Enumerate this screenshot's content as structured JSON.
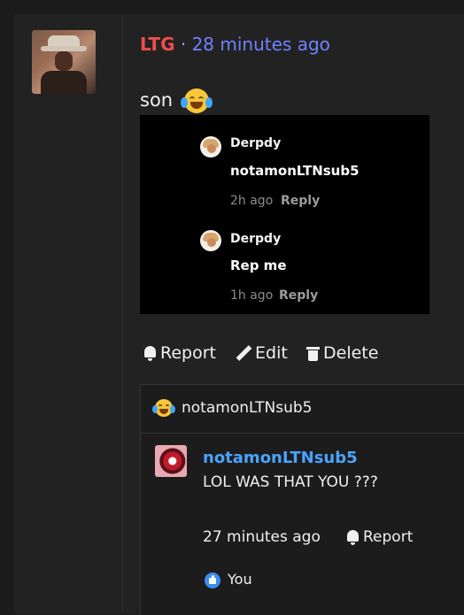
{
  "comment": {
    "author": "LTG",
    "separator": "·",
    "time": "28 minutes ago",
    "body": "son",
    "embed": {
      "replies": [
        {
          "name": "Derpdy",
          "text": "notamonLTNsub5",
          "time": "2h ago",
          "reply_label": "Reply"
        },
        {
          "name": "Derpdy",
          "text": "Rep me",
          "time": "1h ago",
          "reply_label": "Reply"
        }
      ]
    },
    "actions": {
      "report": "Report",
      "edit": "Edit",
      "delete": "Delete"
    }
  },
  "reply_thread": {
    "header": "notamonLTNsub5",
    "reply": {
      "author": "notamonLTNsub5",
      "body": "LOL WAS THAT YOU ???",
      "time": "27 minutes ago",
      "report_label": "Report",
      "like_label": "You"
    }
  },
  "colors": {
    "author": "#f04d4d",
    "time": "#6f82ff",
    "reply_author": "#4aa3ff",
    "background": "#222222"
  }
}
